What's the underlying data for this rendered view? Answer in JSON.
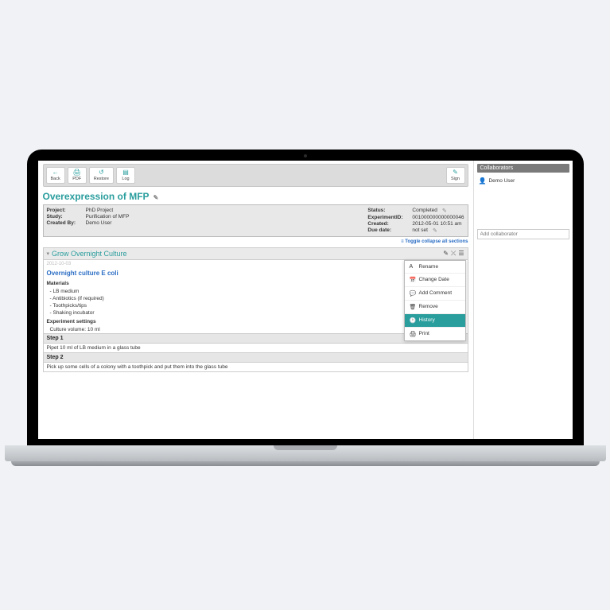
{
  "toolbar": {
    "back": "Back",
    "pdf": "PDF",
    "restore": "Restore",
    "log": "Log",
    "sign": "Sign"
  },
  "title": "Overexpression of MFP",
  "meta": {
    "project_label": "Project:",
    "project_val": "PhD Project",
    "study_label": "Study:",
    "study_val": "Purification of MFP",
    "createdby_label": "Created By:",
    "createdby_val": "Demo User",
    "status_label": "Status:",
    "status_val": "Completed",
    "expid_label": "ExperimentID:",
    "expid_val": "001000000000000046",
    "created_label": "Created:",
    "created_val": "2012-05-01 10:51 am",
    "due_label": "Due date:",
    "due_val": "not set"
  },
  "toggle": "≡ Toggle collapse all sections",
  "section": {
    "title": "Grow Overnight Culture",
    "date": "2012-10-03",
    "subhead": "Overnight culture E coli",
    "materials_head": "Materials",
    "materials": [
      "LB medium",
      "Antibiotics (if required)",
      "Toothpicks/tips",
      "Shaking incubator"
    ],
    "settings_head": "Experiment settings",
    "settings_line": "Culture volume:        10 ml",
    "step1_label": "Step 1",
    "step1_body": "Pipet 10 ml of LB medium in a glass tube",
    "step2_label": "Step 2",
    "step2_body": "Pick up some cells of a colony with a toothpick and put them into the glass tube"
  },
  "menu": {
    "rename": "Rename",
    "change_date": "Change Date",
    "add_comment": "Add Comment",
    "remove": "Remove",
    "history": "History",
    "print": "Print"
  },
  "sidebar": {
    "header": "Collaborators",
    "user": "Demo User",
    "placeholder": "Add collaborator"
  }
}
